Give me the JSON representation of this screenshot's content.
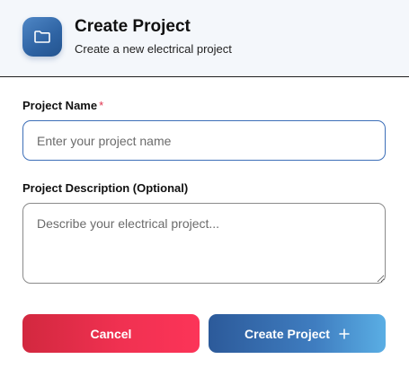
{
  "header": {
    "icon": "folder-icon",
    "title": "Create Project",
    "subtitle": "Create a new electrical project"
  },
  "form": {
    "name": {
      "label": "Project Name",
      "required_mark": "*",
      "value": "",
      "placeholder": "Enter your project name"
    },
    "description": {
      "label": "Project Description (Optional)",
      "value": "",
      "placeholder": "Describe your electrical project..."
    }
  },
  "actions": {
    "cancel_label": "Cancel",
    "create_label": "Create Project",
    "create_icon": "plus-icon"
  },
  "colors": {
    "header_bg": "#f4f7fb",
    "icon_bg": "#2e63a3",
    "required": "#e0334d",
    "input_focus_border": "#3d6fb8",
    "cancel_start": "#d2283f",
    "cancel_end": "#fc3458",
    "create_start": "#2c5a9a",
    "create_end": "#5aaee4"
  }
}
